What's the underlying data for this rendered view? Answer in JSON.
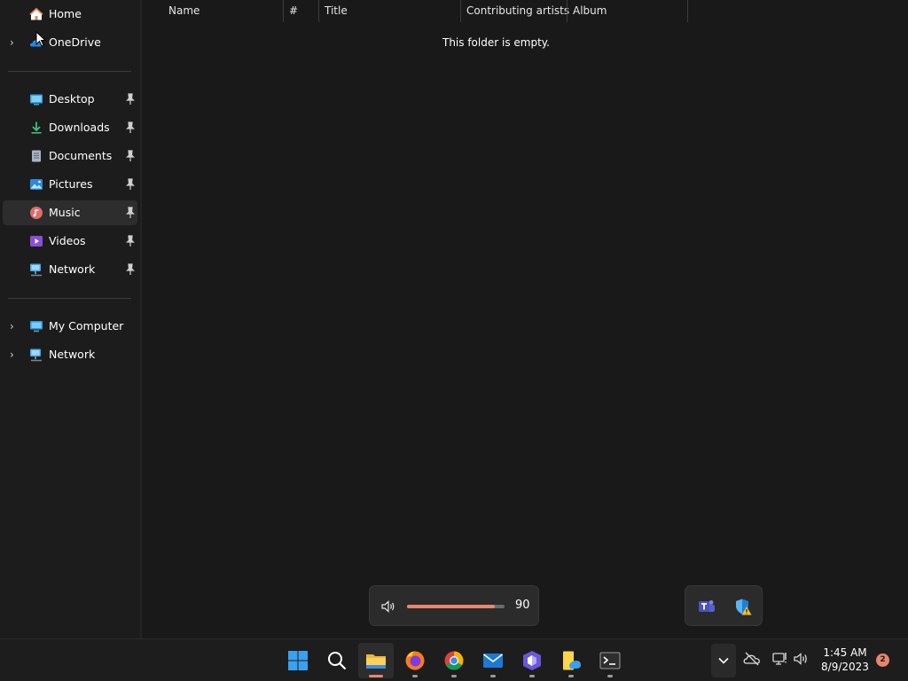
{
  "sidebar": {
    "top": [
      {
        "label": "Home",
        "icon": "home-icon",
        "expandable": false
      },
      {
        "label": "OneDrive",
        "icon": "onedrive-icon",
        "expandable": true
      }
    ],
    "quick_access": [
      {
        "label": "Desktop",
        "icon": "desktop-folder-icon",
        "pinned": true
      },
      {
        "label": "Downloads",
        "icon": "downloads-icon",
        "pinned": true
      },
      {
        "label": "Documents",
        "icon": "documents-icon",
        "pinned": true
      },
      {
        "label": "Pictures",
        "icon": "pictures-icon",
        "pinned": true
      },
      {
        "label": "Music",
        "icon": "music-icon",
        "pinned": true,
        "selected": true
      },
      {
        "label": "Videos",
        "icon": "videos-icon",
        "pinned": true
      },
      {
        "label": "Network",
        "icon": "network-icon",
        "pinned": true
      }
    ],
    "locations": [
      {
        "label": "My Computer",
        "icon": "computer-icon",
        "expandable": true
      },
      {
        "label": "Network",
        "icon": "network-icon",
        "expandable": true
      }
    ]
  },
  "content": {
    "columns": [
      "Name",
      "#",
      "Title",
      "Contributing artists",
      "Album"
    ],
    "sort_column": "Name",
    "empty_message": "This folder is empty."
  },
  "volume_flyout": {
    "value": "90",
    "level": 0.9,
    "accent": "#e7866d"
  },
  "tray_flyout": {
    "icons": [
      "teams-icon",
      "defender-warning-icon"
    ]
  },
  "taskbar": {
    "apps": [
      {
        "name": "start",
        "icon": "windows-start-icon"
      },
      {
        "name": "search",
        "icon": "search-icon"
      },
      {
        "name": "file-explorer",
        "icon": "file-explorer-icon",
        "active": true
      },
      {
        "name": "firefox",
        "icon": "firefox-icon"
      },
      {
        "name": "chrome",
        "icon": "chrome-icon"
      },
      {
        "name": "mail",
        "icon": "mail-icon"
      },
      {
        "name": "vpn",
        "icon": "shield-app-icon"
      },
      {
        "name": "notes",
        "icon": "sticky-notes-icon"
      },
      {
        "name": "terminal",
        "icon": "terminal-icon"
      }
    ],
    "tray": [
      "chevron-up-icon",
      "onedrive-offline-icon",
      "network-status-icon",
      "speaker-icon"
    ],
    "time": "1:45 AM",
    "date": "8/9/2023",
    "notifications": "2"
  }
}
